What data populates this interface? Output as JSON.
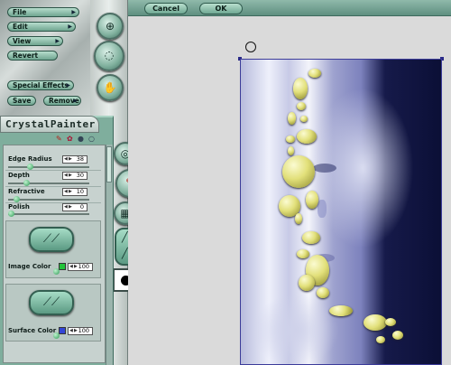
{
  "dialog": {
    "cancel_label": "Cancel",
    "ok_label": "OK"
  },
  "menu": {
    "items": [
      {
        "label": "File"
      },
      {
        "label": "Edit"
      },
      {
        "label": "View"
      },
      {
        "label": "Revert"
      },
      {
        "label": "Special Effects"
      },
      {
        "label": "Save"
      },
      {
        "label": "Remove"
      }
    ]
  },
  "panel": {
    "title": "CrystalPainter",
    "params": [
      {
        "label": "Edge Radius",
        "value": "38"
      },
      {
        "label": "Depth",
        "value": "30"
      },
      {
        "label": "Refractive",
        "value": "10"
      },
      {
        "label": "Polish",
        "value": "0"
      }
    ],
    "image_color": {
      "label": "Image Color",
      "value": "100",
      "swatch": "#22c43a"
    },
    "surface_color": {
      "label": "Surface Color",
      "value": "100",
      "swatch": "#3346d6"
    }
  },
  "icons": {
    "rail": [
      "plus-circle-icon",
      "dial-icon",
      "hand-icon",
      "target-icon",
      "brush-icon",
      "grid-icon",
      "pen-icon",
      "black-circle-swatch-icon"
    ]
  },
  "colors": {
    "accent": "#7fae9d",
    "button": "#6fa590",
    "photo_border": "#3c3c9a"
  }
}
